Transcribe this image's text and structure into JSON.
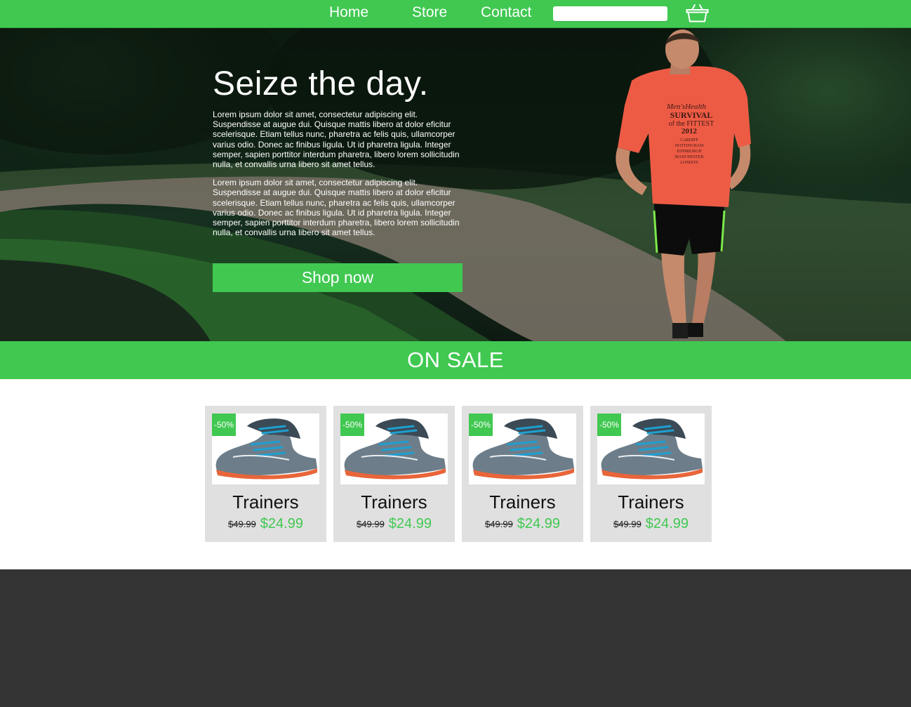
{
  "nav": {
    "links": [
      {
        "label": "Home"
      },
      {
        "label": "Store"
      },
      {
        "label": "Contact"
      }
    ],
    "search": {
      "value": "",
      "placeholder": ""
    },
    "cart_icon": "basket-icon"
  },
  "hero": {
    "title": "Seize the day.",
    "paragraphs": [
      "Lorem ipsum dolor sit amet, consectetur adipiscing elit. Suspendisse at augue dui. Quisque mattis libero at dolor eficitur scelerisque. Etiam tellus nunc, pharetra ac felis quis, ullamcorper varius odio. Donec ac finibus ligula. Ut id pharetra ligula. Integer semper, sapien porttitor interdum pharetra, libero lorem sollicitudin nulla, et convallis urna libero sit amet tellus.",
      "Lorem ipsum dolor sit amet, consectetur adipiscing elit. Suspendisse at augue dui. Quisque mattis libero at dolor eficitur scelerisque. Etiam tellus nunc, pharetra ac felis quis, ullamcorper varius odio. Donec ac finibus ligula. Ut id pharetra ligula. Integer semper, sapien porttitor interdum pharetra, libero lorem sollicitudin nulla, et convallis urna libero sit amet tellus."
    ],
    "button_label": "Shop now",
    "shirt_text": [
      "Men'sHealth",
      "SURVIVAL",
      "of the FITTEST",
      "2012",
      "CARDIFF",
      "NOTTINGHAM",
      "EDINBURGH",
      "MANCHESTER",
      "LONDON"
    ]
  },
  "sale": {
    "heading": "ON SALE"
  },
  "products": [
    {
      "badge": "-50%",
      "name": "Trainers",
      "old_price": "$49.99",
      "new_price": "$24.99"
    },
    {
      "badge": "-50%",
      "name": "Trainers",
      "old_price": "$49.99",
      "new_price": "$24.99"
    },
    {
      "badge": "-50%",
      "name": "Trainers",
      "old_price": "$49.99",
      "new_price": "$24.99"
    },
    {
      "badge": "-50%",
      "name": "Trainers",
      "old_price": "$49.99",
      "new_price": "$24.99"
    }
  ],
  "colors": {
    "accent": "#40c851",
    "footer": "#333333",
    "card": "#e0e0e0"
  }
}
